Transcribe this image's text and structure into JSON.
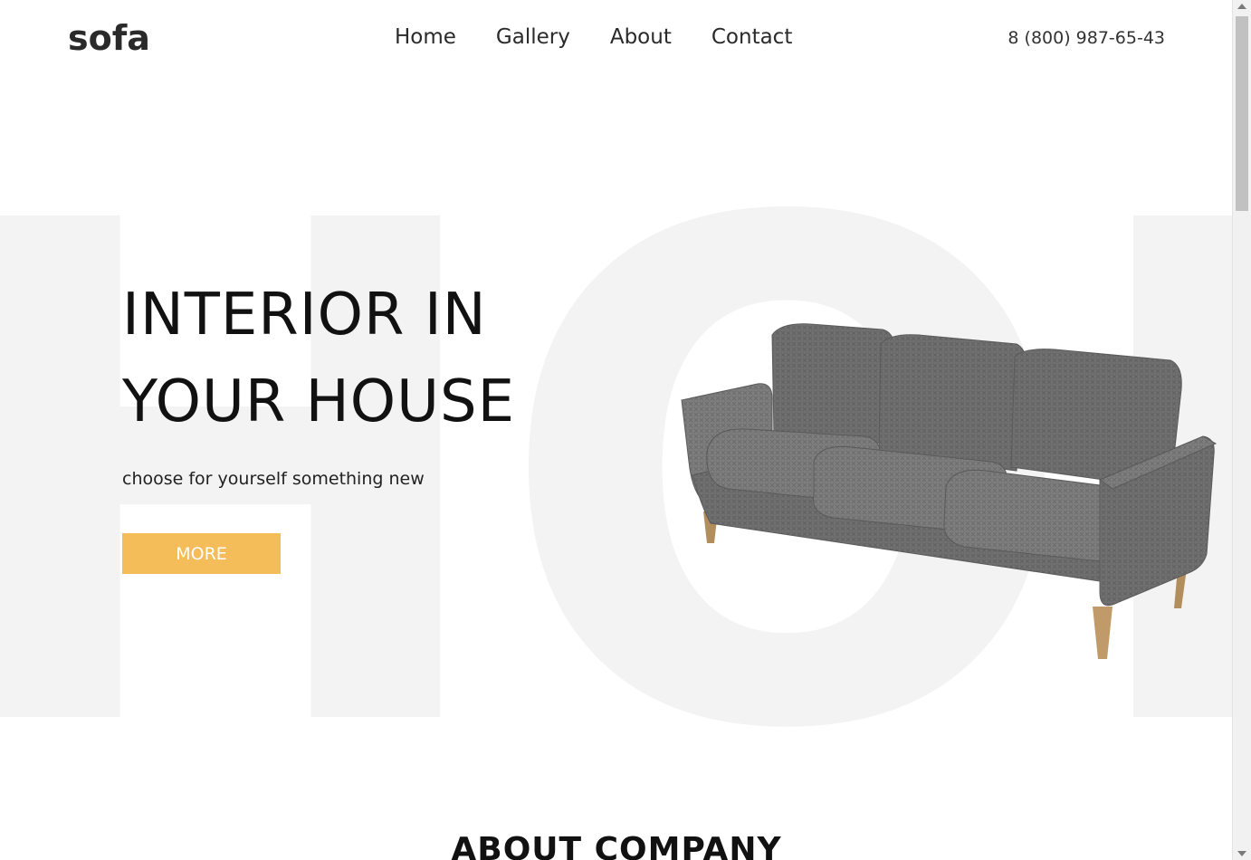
{
  "header": {
    "logo": "sofa",
    "nav": [
      "Home",
      "Gallery",
      "About",
      "Contact"
    ],
    "phone": "8 (800) 987-65-43"
  },
  "hero": {
    "background_word": "HOM",
    "title_line1": "INTERIOR IN",
    "title_line2": "YOUR HOUSE",
    "subtitle": "choose for yourself something new",
    "button_label": "MORE",
    "button_color": "#f5bc5a"
  },
  "about": {
    "heading": "ABOUT COMPANY"
  },
  "images": {
    "sofa": "sofa-image"
  }
}
